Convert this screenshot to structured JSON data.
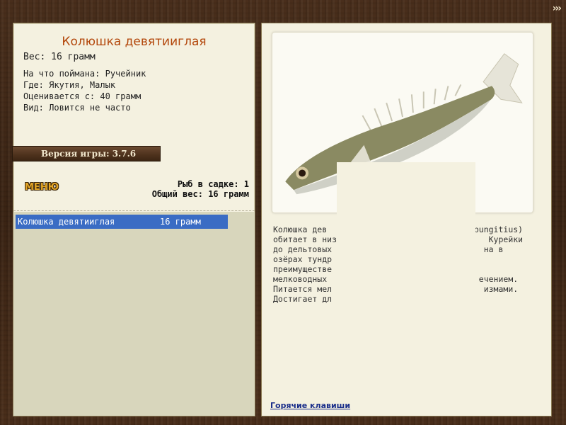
{
  "nav": {
    "arrows": "›››"
  },
  "fish": {
    "title": "Колюшка девятииглая",
    "weight": "Вес: 16 грамм",
    "bait": "На что поймана: Ручейник",
    "location": "Где: Якутия, Малык",
    "valued_from": "Оценивается с: 40 грамм",
    "frequency": "Вид: Ловится не часто"
  },
  "version": {
    "label": "Версия игры: 3.7.6"
  },
  "menu": {
    "label": "МЕНЮ"
  },
  "keepnet": {
    "count": "Рыб в садке: 1",
    "total": "Общий вес: 16 грамм"
  },
  "catch_list": [
    {
      "name": "Колюшка девятииглая",
      "weight": "16 грамм"
    }
  ],
  "description": {
    "lines": [
      "Колюшка дев                              pungitius)",
      "обитает в низ                               Курейки",
      "до дельтовых                               на в",
      "озёрах тундр",
      "преимуществе",
      "мелководных                               ечением.",
      "Питается мел                               измами.",
      "Достигает дл"
    ]
  },
  "hotkeys": {
    "label": "Горячие клавиши"
  },
  "colors": {
    "title": "#b3470b",
    "selection": "#3a6cc4",
    "panel": "#f4f1e0",
    "link": "#1a2e8a"
  },
  "icons": {
    "fish_image": "nine-spined-stickleback-illustration"
  }
}
